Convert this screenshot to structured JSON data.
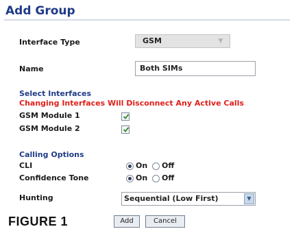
{
  "title": "Add Group",
  "interface_type": {
    "label": "Interface Type",
    "value": "GSM"
  },
  "name": {
    "label": "Name",
    "value": "Both SIMs"
  },
  "select_interfaces": {
    "heading": "Select Interfaces",
    "warning": "Changing Interfaces Will Disconnect Any Active Calls",
    "items": [
      {
        "label": "GSM Module 1",
        "checked": true
      },
      {
        "label": "GSM Module 2",
        "checked": true
      }
    ]
  },
  "calling_options": {
    "heading": "Calling Options",
    "cli": {
      "label": "CLI",
      "on": "On",
      "off": "Off",
      "selected": "On"
    },
    "confidence_tone": {
      "label": "Confidence Tone",
      "on": "On",
      "off": "Off",
      "selected": "On"
    },
    "hunting": {
      "label": "Hunting",
      "value": "Sequential (Low First)"
    }
  },
  "figure_label": "FIGURE 1",
  "buttons": {
    "add": "Add",
    "cancel": "Cancel"
  },
  "colors": {
    "heading": "#1f3b87",
    "warning": "#e0201a"
  },
  "icons": {
    "check": "checkmark-icon",
    "dropdown": "chevron-down-icon"
  }
}
